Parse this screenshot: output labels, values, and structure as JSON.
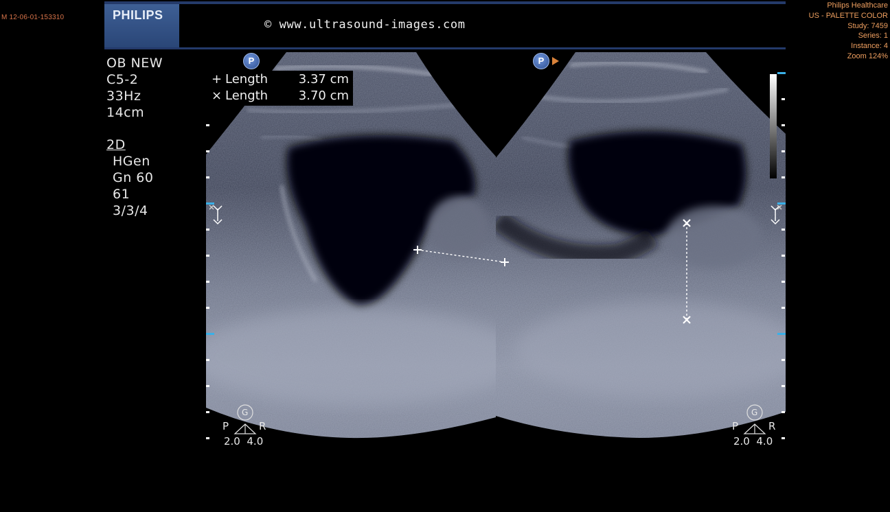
{
  "viewer": {
    "image_id": "M 12-06-01-153310"
  },
  "dicom": {
    "manufacturer": "Philips Healthcare",
    "photometric": "US - PALETTE COLOR",
    "study": "Study: 7459",
    "series": "Series: 1",
    "instance": "Instance: 4",
    "zoom": "Zoom 124%"
  },
  "header": {
    "logo": "PHILIPS",
    "watermark": "© www.ultrasound-images.com"
  },
  "scan_params": {
    "preset": "OB NEW",
    "probe": "C5-2",
    "frame_rate": "33Hz",
    "depth": "14cm",
    "mode": "2D",
    "harmonic": "HGen",
    "gain": "Gn 60",
    "dynamic_range": "61",
    "persistence": "3/3/4"
  },
  "measurements": [
    {
      "symbol": "+",
      "label": "Length",
      "value": "3.37 cm"
    },
    {
      "symbol": "×",
      "label": "Length",
      "value": "3.70 cm"
    }
  ],
  "panels": {
    "left": {
      "badge": "P",
      "gen_icon": "G",
      "p_label": "P",
      "r_label": "R",
      "focus_values": "2.0  4.0"
    },
    "right": {
      "badge": "P",
      "gen_icon": "G",
      "p_label": "P",
      "r_label": "R",
      "focus_values": "2.0  4.0"
    }
  },
  "colors": {
    "background": "#000000",
    "header_bar": "#243a6a",
    "overlay_text": "#f0a060",
    "depth_marker_accent": "#3ab0e8",
    "measurement_caliper": "#ffffff"
  },
  "icons": [
    "philips-logo",
    "p-orientation-badge",
    "orientation-arrow-icon",
    "focus-marker-icon",
    "gen-circle-icon",
    "probe-triangle-icon",
    "plus-caliper-icon",
    "cross-caliper-icon"
  ]
}
